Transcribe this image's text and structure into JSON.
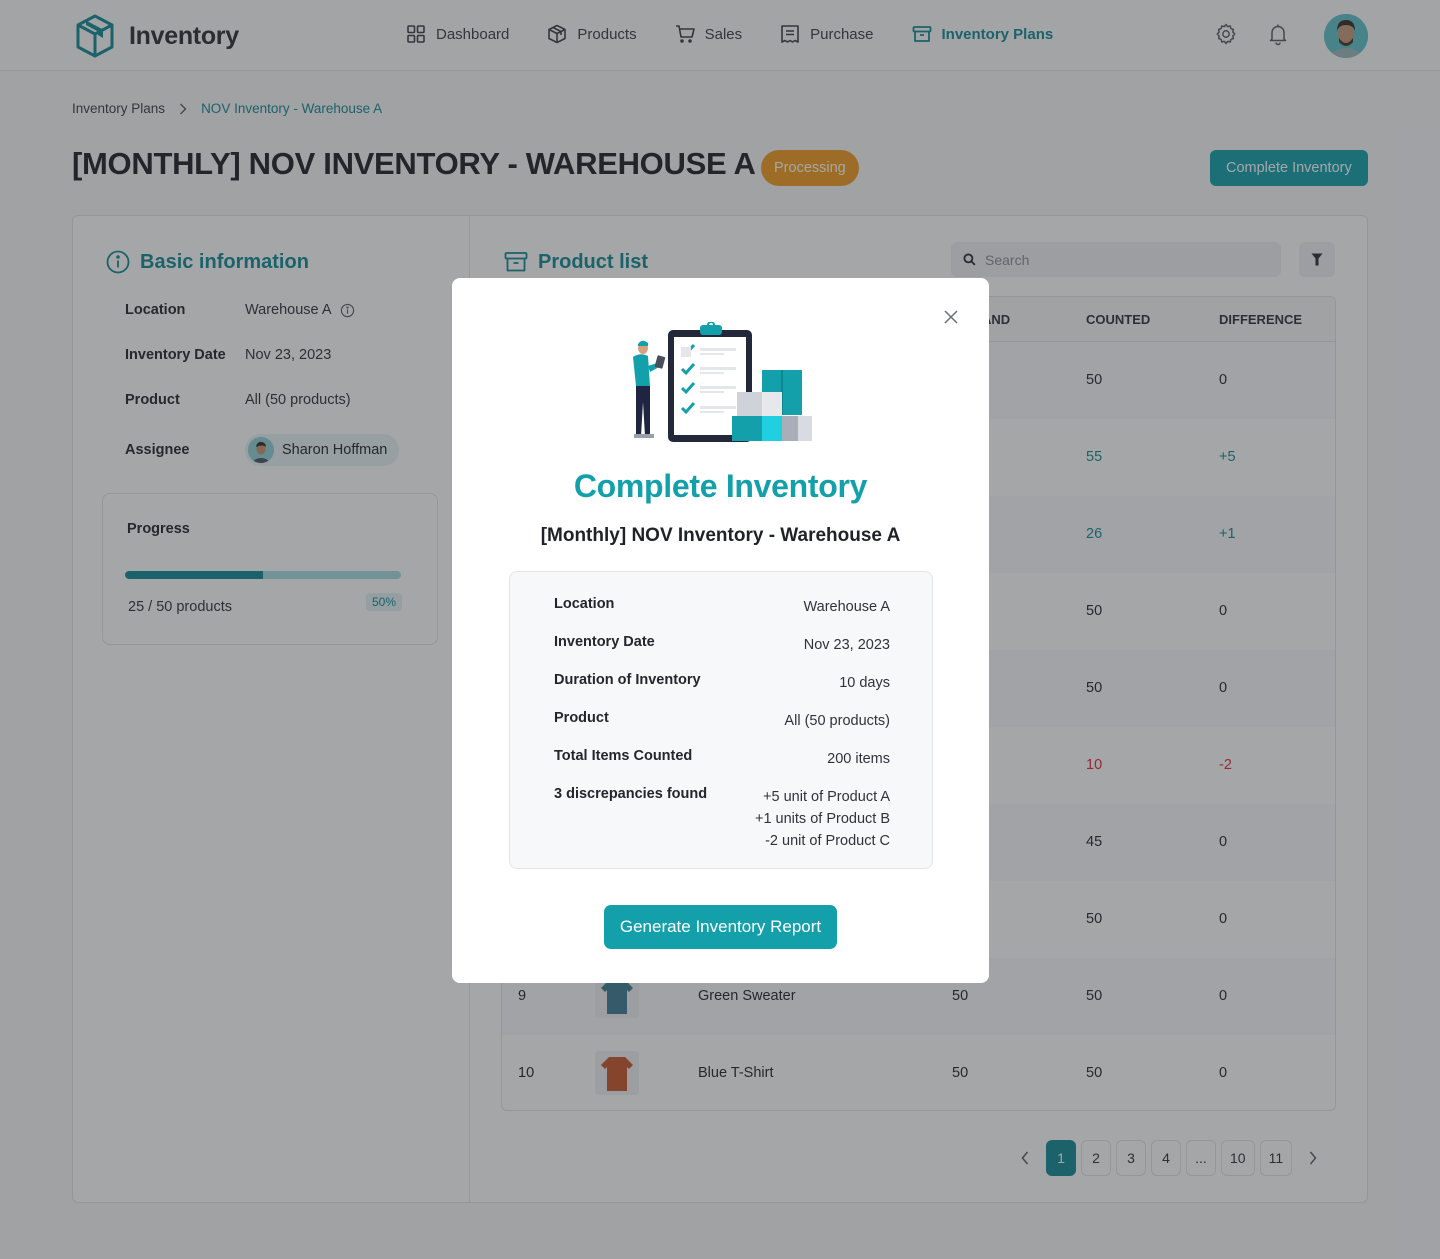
{
  "app": {
    "name": "Inventory",
    "nav": [
      {
        "label": "Dashboard",
        "icon": "grid-icon",
        "active": false
      },
      {
        "label": "Products",
        "icon": "box-icon",
        "active": false
      },
      {
        "label": "Sales",
        "icon": "cart-icon",
        "active": false
      },
      {
        "label": "Purchase",
        "icon": "receipt-icon",
        "active": false
      },
      {
        "label": "Inventory Plans",
        "icon": "archive-icon",
        "active": true
      }
    ]
  },
  "breadcrumb": {
    "root": "Inventory Plans",
    "current": "NOV Inventory - Warehouse A"
  },
  "page": {
    "title": "[MONTHLY] NOV INVENTORY - WAREHOUSE A",
    "status": "Processing",
    "complete_button": "Complete Inventory"
  },
  "basic_info": {
    "title": "Basic information",
    "rows": [
      {
        "label": "Location",
        "value": "Warehouse A"
      },
      {
        "label": "Inventory Date",
        "value": "Nov 23, 2023"
      },
      {
        "label": "Product",
        "value": "All (50 products)"
      },
      {
        "label": "Assignee",
        "value": "Sharon Hoffman"
      }
    ],
    "progress": {
      "title": "Progress",
      "text": "25 / 50 products",
      "percent_label": "50%",
      "fraction": 0.5
    }
  },
  "product_list": {
    "title": "Product list",
    "search_placeholder": "Search",
    "columns": {
      "on_hand": "AND",
      "counted": "COUNTED",
      "difference": "DIFFERENCE"
    },
    "rows": [
      {
        "no": "",
        "name": "",
        "on_hand": "",
        "counted": "50",
        "difference": "0",
        "type": "zero"
      },
      {
        "no": "",
        "name": "",
        "on_hand": "",
        "counted": "55",
        "difference": "+5",
        "type": "pos"
      },
      {
        "no": "",
        "name": "",
        "on_hand": "",
        "counted": "26",
        "difference": "+1",
        "type": "pos"
      },
      {
        "no": "",
        "name": "",
        "on_hand": "",
        "counted": "50",
        "difference": "0",
        "type": "zero"
      },
      {
        "no": "",
        "name": "",
        "on_hand": "",
        "counted": "50",
        "difference": "0",
        "type": "zero"
      },
      {
        "no": "",
        "name": "",
        "on_hand": "",
        "counted": "10",
        "difference": "-2",
        "type": "neg"
      },
      {
        "no": "",
        "name": "",
        "on_hand": "",
        "counted": "45",
        "difference": "0",
        "type": "zero"
      },
      {
        "no": "",
        "name": "",
        "on_hand": "",
        "counted": "50",
        "difference": "0",
        "type": "zero"
      },
      {
        "no": "9",
        "name": "Green Sweater",
        "on_hand": "50",
        "counted": "50",
        "difference": "0",
        "type": "zero"
      },
      {
        "no": "10",
        "name": "Blue T-Shirt",
        "on_hand": "50",
        "counted": "50",
        "difference": "0",
        "type": "zero"
      }
    ],
    "pagination": [
      "1",
      "2",
      "3",
      "4",
      "...",
      "10",
      "11"
    ],
    "current_page": "1"
  },
  "modal": {
    "title": "Complete Inventory",
    "subtitle": "[Monthly] NOV Inventory - Warehouse A",
    "summary": [
      {
        "label": "Location",
        "value": "Warehouse A"
      },
      {
        "label": "Inventory Date",
        "value": "Nov 23, 2023"
      },
      {
        "label": "Duration of Inventory",
        "value": "10 days"
      },
      {
        "label": "Product",
        "value": "All (50 products)"
      },
      {
        "label": "Total Items Counted",
        "value": "200 items"
      }
    ],
    "discrepancies": {
      "label": "3 discrepancies found",
      "items": [
        "+5 unit of Product A",
        "+1 units of Product B",
        "-2 unit of Product C"
      ]
    },
    "generate_button": "Generate Inventory Report"
  },
  "colors": {
    "accent": "#14a0ab",
    "accent_dark": "#138a94",
    "status_processing": "#f29c1f",
    "negative": "#e02a3a"
  }
}
